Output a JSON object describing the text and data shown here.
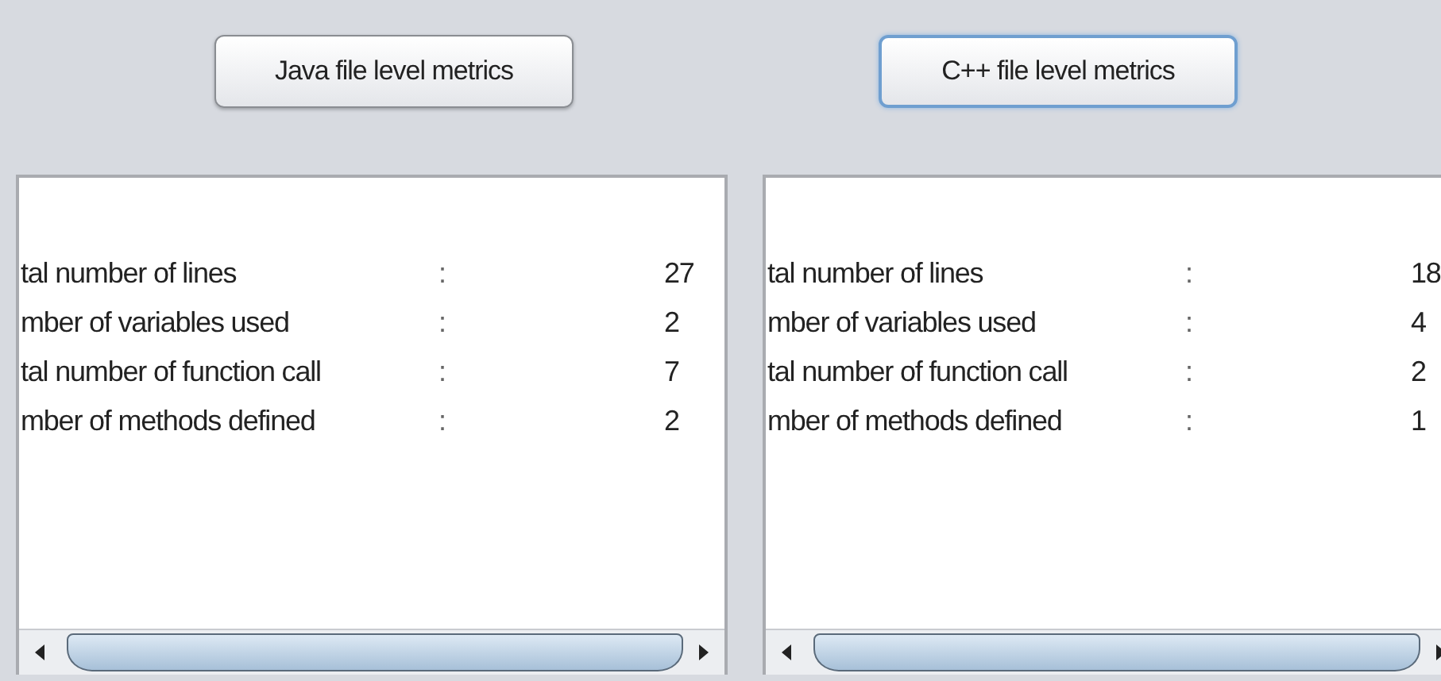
{
  "buttons": [
    {
      "label": "Java file level metrics",
      "focused": false
    },
    {
      "label": "C++ file level metrics",
      "focused": true
    }
  ],
  "panels": [
    {
      "rows": [
        {
          "label": "tal number of lines",
          "separator": ":",
          "value": "27"
        },
        {
          "label": "mber of variables used",
          "separator": ":",
          "value": "2"
        },
        {
          "label": "tal number of function call",
          "separator": ":",
          "value": "7"
        },
        {
          "label": "mber of methods defined",
          "separator": ":",
          "value": "2"
        }
      ]
    },
    {
      "rows": [
        {
          "label": "tal number of lines",
          "separator": ":",
          "value": "18"
        },
        {
          "label": "mber of variables used",
          "separator": ":",
          "value": "4"
        },
        {
          "label": "tal number of function call",
          "separator": ":",
          "value": "2"
        },
        {
          "label": "mber of methods defined",
          "separator": ":",
          "value": "1"
        }
      ]
    }
  ]
}
